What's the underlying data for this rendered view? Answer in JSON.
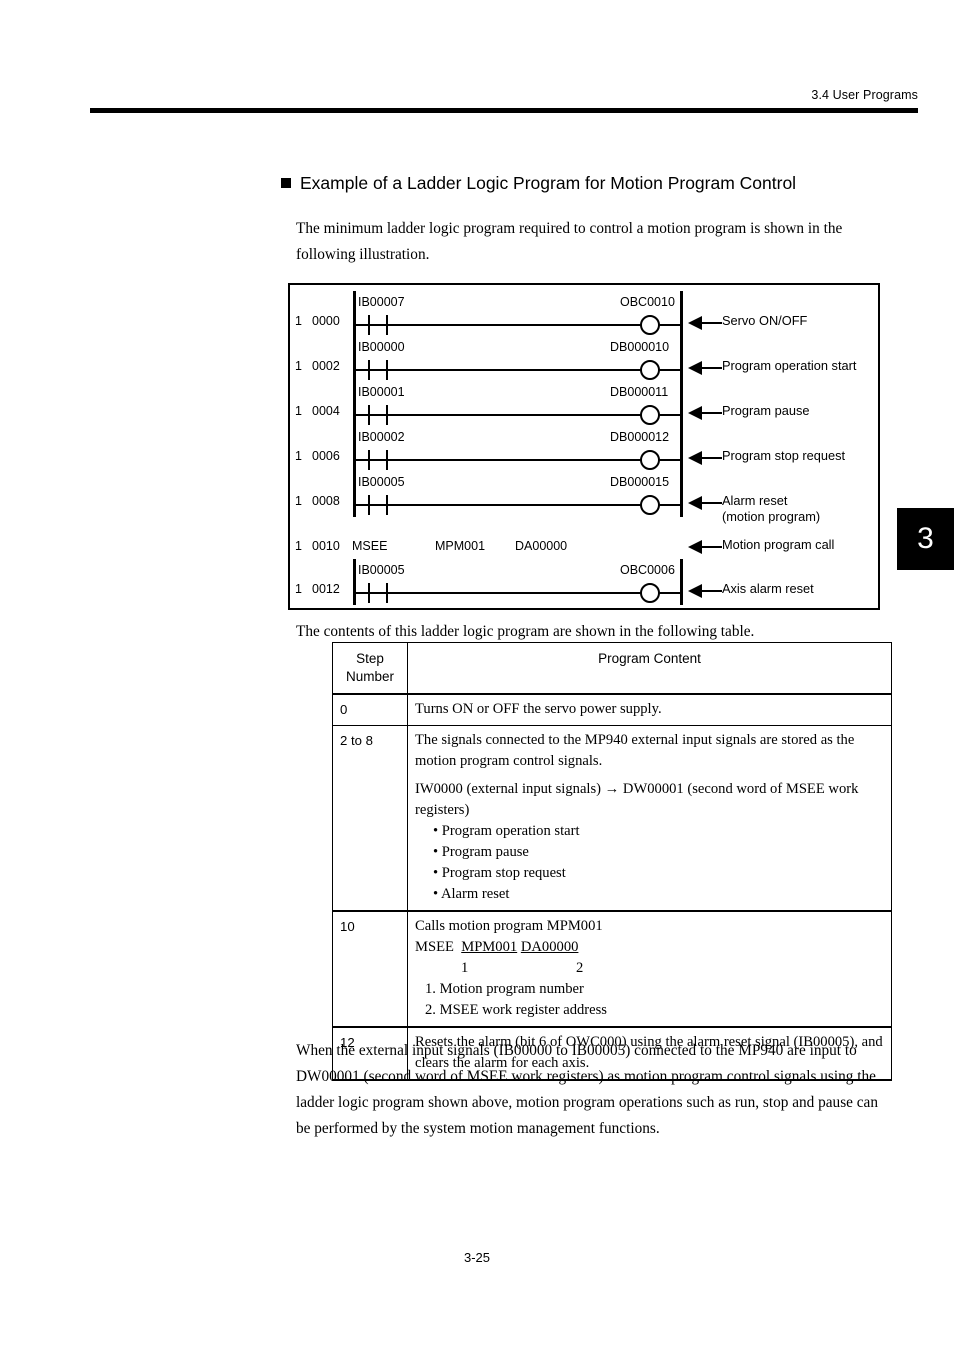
{
  "header": {
    "section_ref": "3.4  User Programs"
  },
  "chapter_tab": {
    "number": "3"
  },
  "heading": {
    "title": "Example of a Ladder Logic Program for Motion Program Control"
  },
  "intro_paragraph": "The minimum ladder logic program required to control a motion program is shown in the following illustration.",
  "table_lead_paragraph": "The contents of this ladder logic program are shown in the following table.",
  "ladder": {
    "rungs": [
      {
        "network": "1",
        "step": "0000",
        "input": "IB00007",
        "output": "OBC0010",
        "annotation": "Servo ON/OFF",
        "annotation2": ""
      },
      {
        "network": "1",
        "step": "0002",
        "input": "IB00000",
        "output": "DB000010",
        "annotation": "Program operation start",
        "annotation2": ""
      },
      {
        "network": "1",
        "step": "0004",
        "input": "IB00001",
        "output": "DB000011",
        "annotation": "Program pause",
        "annotation2": ""
      },
      {
        "network": "1",
        "step": "0006",
        "input": "IB00002",
        "output": "DB000012",
        "annotation": "Program stop request",
        "annotation2": ""
      },
      {
        "network": "1",
        "step": "0008",
        "input": "IB00005",
        "output": "DB000015",
        "annotation": "Alarm reset",
        "annotation2": "(motion program)"
      }
    ],
    "msee_row": {
      "network": "1",
      "step": "0010",
      "instruction": "MSEE",
      "arg1": "MPM001",
      "arg2": "DA00000",
      "annotation": "Motion program call"
    },
    "last_rung": {
      "network": "1",
      "step": "0012",
      "input": "IB00005",
      "output": "OBC0006",
      "annotation": "Axis alarm reset"
    }
  },
  "content_table": {
    "headers": {
      "step_number": "Step\nNumber",
      "step_number_line1": "Step",
      "step_number_line2": "Number",
      "program_content": "Program Content"
    },
    "rows": [
      {
        "step": "0",
        "lines": [
          "Turns ON or OFF the servo power supply."
        ]
      },
      {
        "step": "2 to 8",
        "line1": "The signals connected to the MP940 external input signals are stored as the motion program control signals.",
        "line2": "IW0000 (external input signals)  → DW00001 (second word of MSEE work registers)",
        "bullets": [
          "• Program operation start",
          "• Program pause",
          "• Program stop request",
          "• Alarm reset"
        ]
      },
      {
        "step": "10",
        "line1": "Calls motion program MPM001",
        "msee_prefix": "MSEE",
        "msee_arg1": "MPM001",
        "msee_arg2": "DA00000",
        "markers": "1                    2",
        "note1": "1.  Motion program number",
        "note2": "2.  MSEE work register address"
      },
      {
        "step": "12",
        "lines": [
          "Resets the alarm (bit 6 of OWC000) using the alarm reset signal (IB00005), and clears the alarm for each axis."
        ]
      }
    ]
  },
  "closing_paragraph": "When the external input signals (IB00000 to IB00005) connected to the MP940 are input to DW00001 (second word of MSEE work registers) as motion program control signals using the ladder logic program shown above, motion program operations such as run, stop and pause can be performed by the system motion management functions.",
  "footer": {
    "page_number": "3-25"
  }
}
